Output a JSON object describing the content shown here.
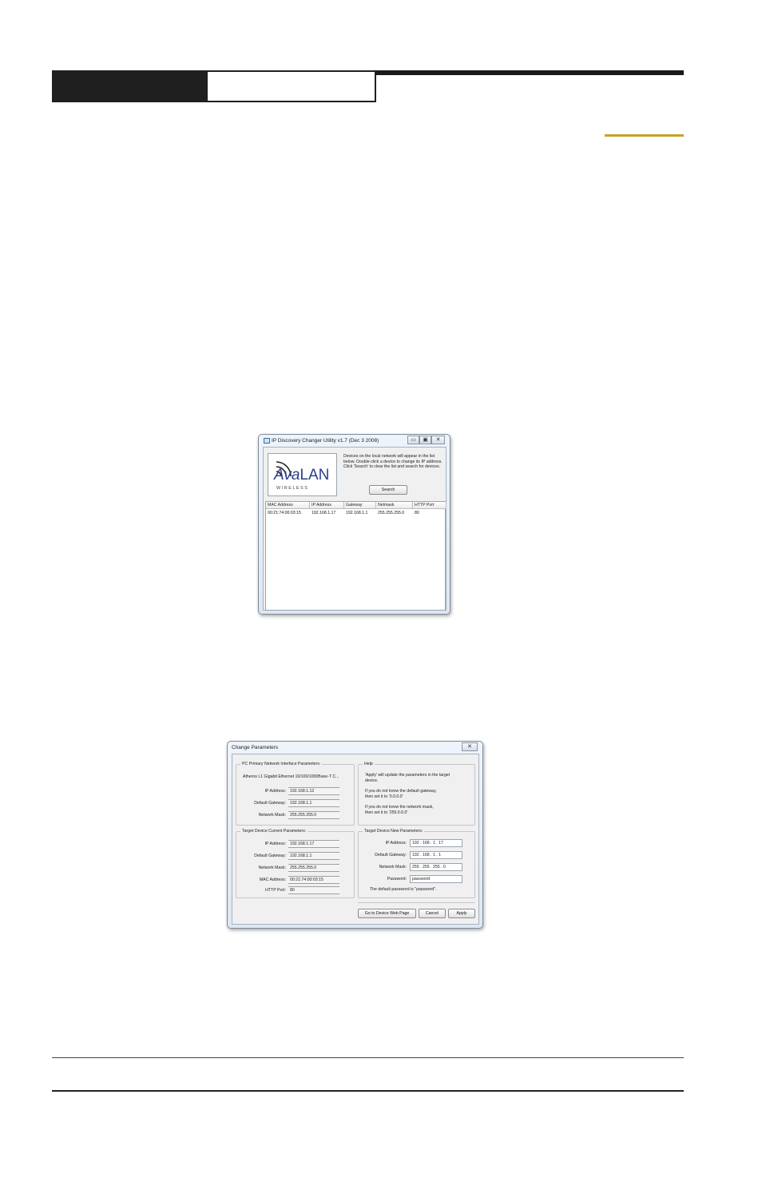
{
  "discovery_window": {
    "title": "IP Discovery Changer Utility v1.7 (Dec  3 2008)",
    "logo": {
      "brand_ava": "Ava",
      "brand_lan": "LAN",
      "tagline": "W I R E L E S S"
    },
    "description": "Devices on the local network will appear in the list below. Double-click a device to change its IP address. Click 'Search' to clear the list and search for devices.",
    "search_label": "Search",
    "columns": [
      "MAC Address",
      "IP Address",
      "Gateway",
      "Netmask",
      "HTTP Port"
    ],
    "row": {
      "mac": "00:21:74:00:03:15",
      "ip": "192.168.1.17",
      "gateway": "192.168.1.1",
      "netmask": "255.255.255.0",
      "port": "80"
    }
  },
  "change_window": {
    "title": "Change Parameters",
    "pc_group": {
      "title": "PC Primary Network Interface Parameters:",
      "adapter": "Atheros L1 Gigabit Ethernet 10/100/1000Base-T C...",
      "ip_label": "IP Address:",
      "ip_value": "192.168.1.12",
      "gw_label": "Default Gateway:",
      "gw_value": "192.168.1.1",
      "mask_label": "Network Mask:",
      "mask_value": "255.255.255.0"
    },
    "help_group": {
      "title": "Help",
      "text1": "'Apply' will update the parameters in the target\ndevice.",
      "text2": "If you do not know the default gateway,\n then set it to '0.0.0.0'",
      "text3": "If you do not know the network mask,\n then set it to '255.0.0.0'"
    },
    "current_group": {
      "title": "Target Device Current Parameters:",
      "ip_label": "IP Address:",
      "ip_value": "192.168.1.17",
      "gw_label": "Default Gateway:",
      "gw_value": "192.168.1.1",
      "mask_label": "Network Mask:",
      "mask_value": "255.255.255.0",
      "mac_label": "MAC Address:",
      "mac_value": "00:21:74:00:03:15",
      "port_label": "HTTP Port:",
      "port_value": "80"
    },
    "new_group": {
      "title": "Target Device New Parameters:",
      "ip_label": "IP Address:",
      "ip_value": "192 . 168 .  1  .  17",
      "gw_label": "Default Gateway:",
      "gw_value": "192 . 168 .  1  .  1",
      "mask_label": "Network Mask:",
      "mask_value": "255 . 255 . 255 .  0",
      "pw_label": "Password:",
      "pw_value": "password",
      "note": "The default password is \"password\"."
    },
    "buttons": {
      "web": "Go to Device Web Page",
      "cancel": "Cancel",
      "apply": "Apply"
    }
  }
}
